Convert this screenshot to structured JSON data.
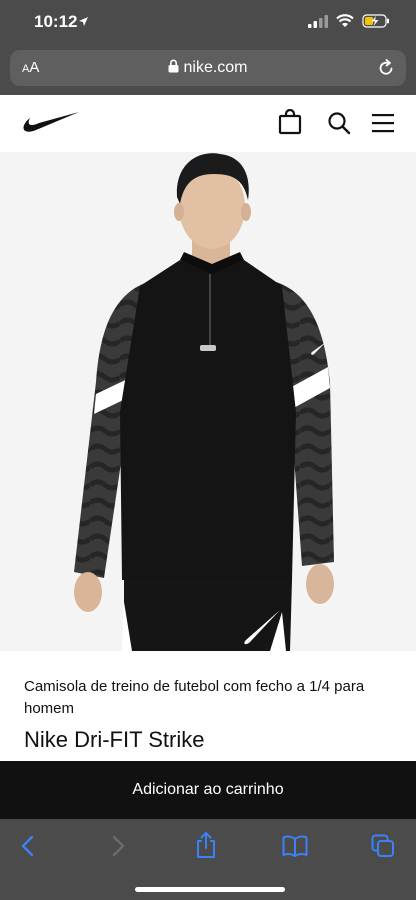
{
  "status": {
    "time": "10:12"
  },
  "browser": {
    "aa_label": "AA",
    "url": "nike.com"
  },
  "product": {
    "subtitle": "Camisola de treino de futebol com fecho a 1/4 para homem",
    "name": "Nike Dri-FIT Strike"
  },
  "cart": {
    "button_label": "Adicionar ao carrinho"
  },
  "colors": {
    "brand_black": "#111111",
    "safari_chrome": "#4b4b4b",
    "link_blue": "#3b82f6"
  },
  "icons": [
    "location-arrow-icon",
    "signal-icon",
    "wifi-icon",
    "battery-icon",
    "lock-icon",
    "reload-icon",
    "nike-swoosh-icon",
    "bag-icon",
    "search-icon",
    "menu-icon",
    "back-icon",
    "forward-icon",
    "share-icon",
    "bookmarks-icon",
    "tabs-icon"
  ]
}
